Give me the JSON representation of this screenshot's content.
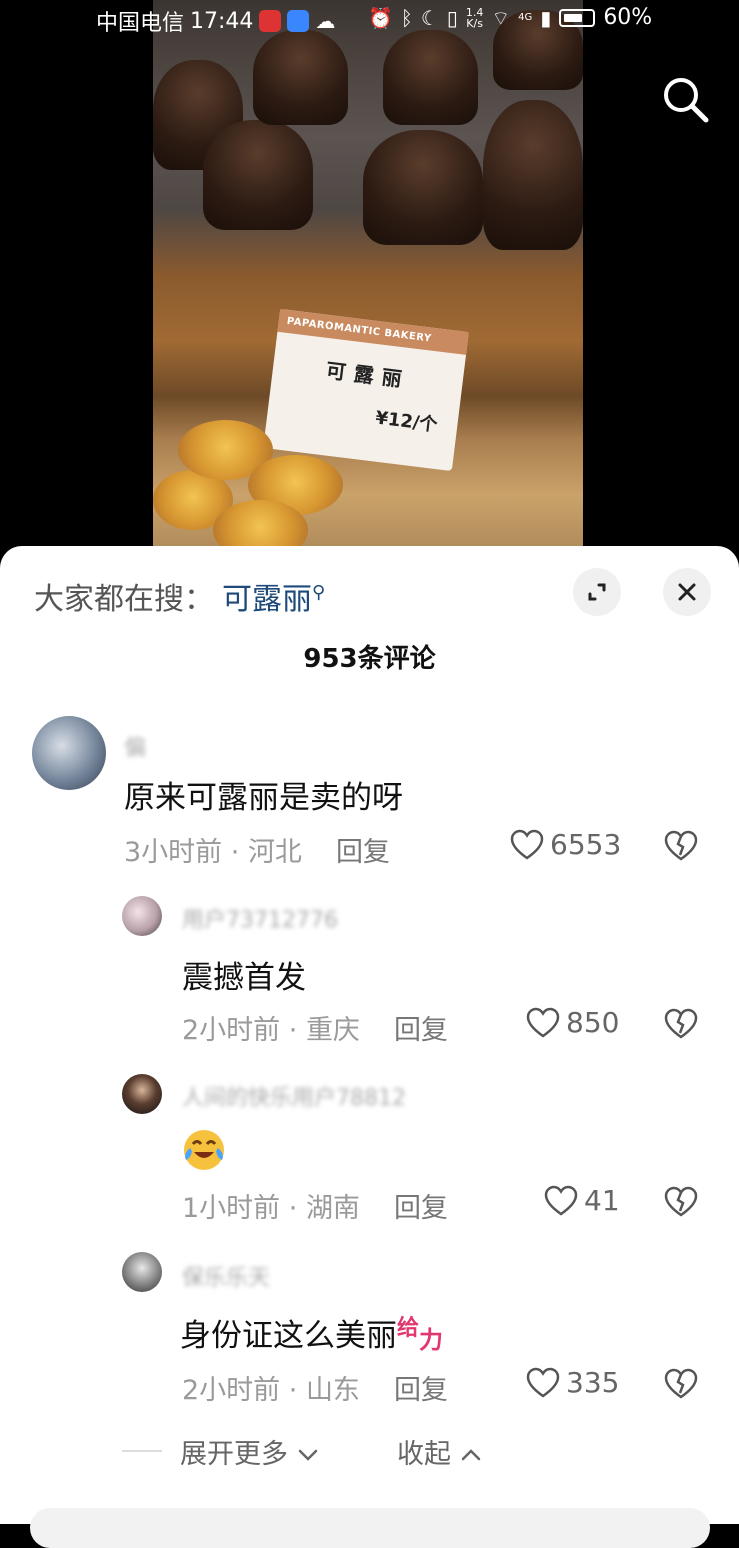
{
  "status_bar": {
    "carrier": "中国电信",
    "time": "17:44",
    "net_speed_top": "1.4",
    "net_speed_bottom": "K/s",
    "network": "4G",
    "battery": "60%"
  },
  "video": {
    "price_tag": {
      "brand": "PAPAROMANTIC BAKERY",
      "product": "可露丽",
      "price": "¥12/个"
    }
  },
  "hot_search": {
    "label": "大家都在搜：",
    "keyword": "可露丽"
  },
  "comments_count": "953条评论",
  "comments": [
    {
      "username": "偏",
      "text": "原来可露丽是卖的呀",
      "time": "3小时前",
      "location": "河北",
      "reply": "回复",
      "likes": "6553"
    },
    {
      "username": "用户73712776",
      "text": "震撼首发",
      "time": "2小时前",
      "location": "重庆",
      "reply": "回复",
      "likes": "850"
    },
    {
      "username": "人间的快乐用户78812",
      "text": "",
      "time": "1小时前",
      "location": "湖南",
      "reply": "回复",
      "likes": "41"
    },
    {
      "username": "保乐乐天",
      "text": "身份证这么美丽",
      "time": "2小时前",
      "location": "山东",
      "reply": "回复",
      "likes": "335"
    }
  ],
  "sticker": {
    "top": "给",
    "bottom": "力"
  },
  "footer": {
    "expand_more": "展开更多",
    "collapse": "收起"
  },
  "icons": [
    "search-icon",
    "expand-icon",
    "close-icon",
    "heart-icon",
    "dislike-icon",
    "laughing-crying-emoji",
    "chevron-down-icon",
    "chevron-up-icon"
  ],
  "colors": {
    "keyword": "#1e4a7a",
    "sticker": "#e2366e"
  }
}
